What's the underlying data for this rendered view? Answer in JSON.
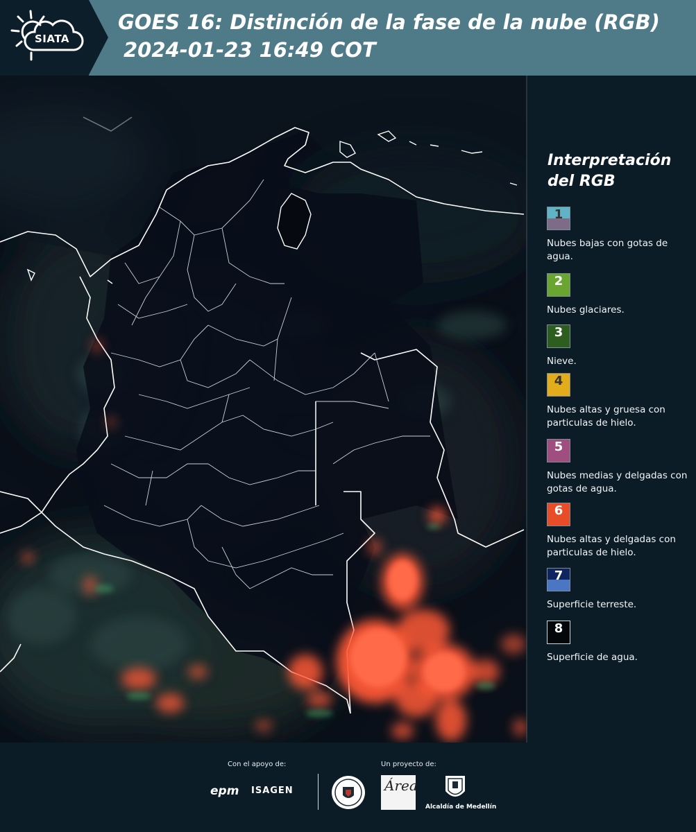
{
  "header": {
    "logo_text": "SIATA",
    "title_line1": "GOES 16: Distinción de la fase de la nube (RGB)",
    "title_line2": "2024-01-23 16:49 COT"
  },
  "legend": {
    "title": "Interpretación del RGB",
    "items": [
      {
        "num": "1",
        "label": "Nubes bajas con gotas de agua.",
        "color_top": "#5fb3c4",
        "color_bottom": "#7d6b87",
        "num_color": "#333333"
      },
      {
        "num": "2",
        "label": "Nubes glaciares.",
        "color_top": "#6aa531",
        "color_bottom": "#6aa531",
        "num_color": "#ffffff"
      },
      {
        "num": "3",
        "label": "Nieve.",
        "color_top": "#2e5e1f",
        "color_bottom": "#2e5e1f",
        "num_color": "#ffffff"
      },
      {
        "num": "4",
        "label": "Nubes altas y gruesa con particulas de hielo.",
        "color_top": "#e3ac1a",
        "color_bottom": "#e3ac1a",
        "num_color": "#333333"
      },
      {
        "num": "5",
        "label": "Nubes medias y delgadas con gotas de agua.",
        "color_top": "#a04d7f",
        "color_bottom": "#a04d7f",
        "num_color": "#ffffff"
      },
      {
        "num": "6",
        "label": "Nubes altas y delgadas con particulas de hielo.",
        "color_top": "#e84d27",
        "color_bottom": "#e84d27",
        "num_color": "#ffffff"
      },
      {
        "num": "7",
        "label": "Superficie terreste.",
        "color_top": "#0f2560",
        "color_bottom": "#4a76c4",
        "num_color": "#ffffff"
      },
      {
        "num": "8",
        "label": "Superficie de agua.",
        "color_top": "#03070a",
        "color_bottom": "#03070a",
        "num_color": "#ffffff"
      }
    ]
  },
  "footer": {
    "support_label": "Con el apoyo de:",
    "project_label": "Un proyecto de:",
    "epm_logo": "epm",
    "isagen_logo": "ISAGEN",
    "area_logo": "Área",
    "medellin_label": "Alcaldía de Medellín"
  },
  "colors": {
    "header_bg": "#4f7b89",
    "panel_bg": "#0b1c27",
    "cloud_ice": "#ff5a36",
    "border_line": "#ffffff"
  }
}
